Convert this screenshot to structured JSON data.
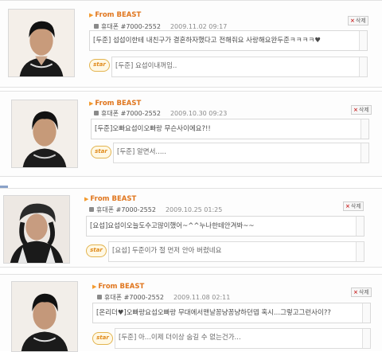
{
  "messages": [
    {
      "from": "From BEAST",
      "sender": "휴대폰 #7000-2552",
      "date": "2009.11.02 09:17",
      "delete_label": "삭제",
      "text": "[두준] 섭섭이한테 내친구가 결혼하자했다고 전해줘요 사랑해요완두준ㅋㅋㅋㅋ♥",
      "star_label": "star",
      "reply": "[두준] 요섭이내꺼임..",
      "avatar": "male-portrait"
    },
    {
      "from": "From BEAST",
      "sender": "휴대폰 #7000-2552",
      "date": "2009.10.30 09:23",
      "delete_label": "삭제",
      "text": "[두준]오빠요섭이오빠랑 무슨사이에요?!!",
      "star_label": "star",
      "reply": "[두준] 알면서.....",
      "avatar": "male-portrait"
    },
    {
      "from": "From BEAST",
      "sender": "휴대폰 #7000-2552",
      "date": "2009.10.25 01:25",
      "delete_label": "삭제",
      "text": "[요섭]요섭이오늘도수고많이했어~^^누나한테안겨봐~~",
      "star_label": "star",
      "reply": "[요섭] 두준이가 절 먼저 안아 버렸네요",
      "avatar": "female-portrait"
    },
    {
      "from": "From BEAST",
      "sender": "휴대폰 #7000-2552",
      "date": "2009.11.08 02:11",
      "delete_label": "삭제",
      "text": "[온리더♥]오빠랑요섭오빠랑 무대에서맨날꽁냥꽁냥하던뎁 혹시...그렇고그런사이??",
      "star_label": "star",
      "reply": "[두준] 아...이제 더이상 숨길 수 없는건가...",
      "avatar": "male-portrait"
    }
  ],
  "colors": {
    "accent_orange": "#e0761e",
    "star_border": "#e3b44f",
    "border_gray": "#d9d9d9"
  }
}
